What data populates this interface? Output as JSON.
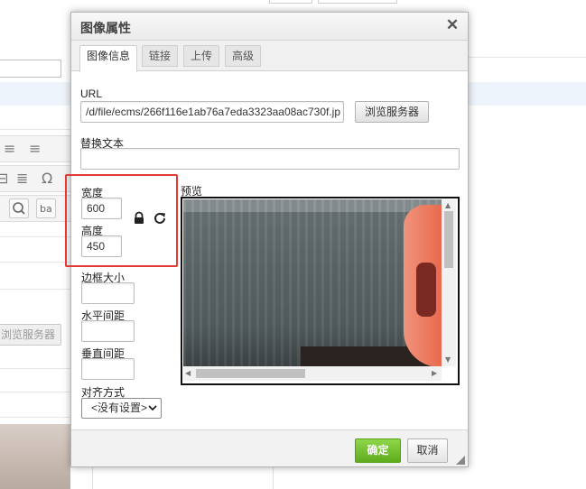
{
  "background": {
    "browse_button_label": "浏览服务器",
    "toolbar_glyphs": [
      "≡",
      "≡",
      "⊟",
      "≣",
      "Ω"
    ]
  },
  "dialog": {
    "title": "图像属性",
    "close_glyph": "✕",
    "tabs": [
      {
        "label": "图像信息",
        "active": true
      },
      {
        "label": "链接",
        "active": false
      },
      {
        "label": "上传",
        "active": false
      },
      {
        "label": "高级",
        "active": false
      }
    ],
    "url": {
      "label": "URL",
      "value": "/d/file/ecms/266f116e1ab76a7eda3323aa08ac730f.jp",
      "browse_button": "浏览服务器"
    },
    "alt_text": {
      "label": "替换文本",
      "value": ""
    },
    "width": {
      "label": "宽度",
      "value": "600"
    },
    "height": {
      "label": "高度",
      "value": "450"
    },
    "border": {
      "label": "边框大小",
      "value": ""
    },
    "hspace": {
      "label": "水平间距",
      "value": ""
    },
    "vspace": {
      "label": "垂直间距",
      "value": ""
    },
    "align": {
      "label": "对齐方式",
      "selected": "<没有设置>"
    },
    "preview": {
      "label": "预览"
    },
    "footer": {
      "ok": "确定",
      "cancel": "取消"
    }
  },
  "colors": {
    "highlight_border": "#e53935",
    "ok_button": "#6cbf27",
    "titlebar": "#efefef"
  },
  "icons": [
    "lock-icon",
    "reset-size-icon",
    "close-icon",
    "resize-grip-icon",
    "chevron-down-icon"
  ]
}
